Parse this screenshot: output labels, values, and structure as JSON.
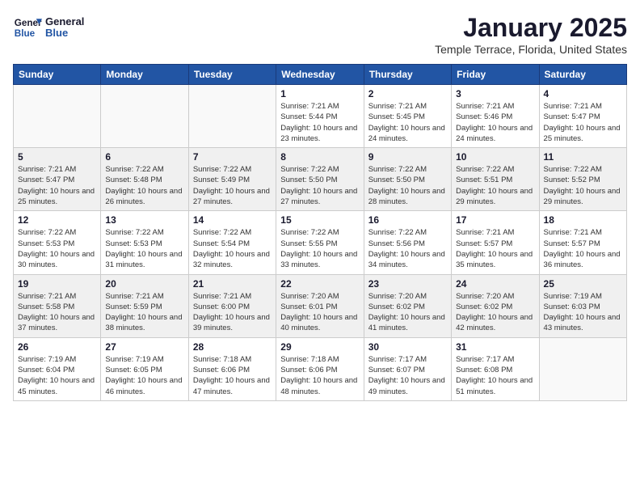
{
  "logo": {
    "line1": "General",
    "line2": "Blue"
  },
  "title": "January 2025",
  "subtitle": "Temple Terrace, Florida, United States",
  "days_of_week": [
    "Sunday",
    "Monday",
    "Tuesday",
    "Wednesday",
    "Thursday",
    "Friday",
    "Saturday"
  ],
  "weeks": [
    {
      "shaded": false,
      "days": [
        {
          "num": "",
          "empty": true
        },
        {
          "num": "",
          "empty": true
        },
        {
          "num": "",
          "empty": true
        },
        {
          "num": "1",
          "sunrise": "7:21 AM",
          "sunset": "5:44 PM",
          "daylight": "10 hours and 23 minutes."
        },
        {
          "num": "2",
          "sunrise": "7:21 AM",
          "sunset": "5:45 PM",
          "daylight": "10 hours and 24 minutes."
        },
        {
          "num": "3",
          "sunrise": "7:21 AM",
          "sunset": "5:46 PM",
          "daylight": "10 hours and 24 minutes."
        },
        {
          "num": "4",
          "sunrise": "7:21 AM",
          "sunset": "5:47 PM",
          "daylight": "10 hours and 25 minutes."
        }
      ]
    },
    {
      "shaded": true,
      "days": [
        {
          "num": "5",
          "sunrise": "7:21 AM",
          "sunset": "5:47 PM",
          "daylight": "10 hours and 25 minutes."
        },
        {
          "num": "6",
          "sunrise": "7:22 AM",
          "sunset": "5:48 PM",
          "daylight": "10 hours and 26 minutes."
        },
        {
          "num": "7",
          "sunrise": "7:22 AM",
          "sunset": "5:49 PM",
          "daylight": "10 hours and 27 minutes."
        },
        {
          "num": "8",
          "sunrise": "7:22 AM",
          "sunset": "5:50 PM",
          "daylight": "10 hours and 27 minutes."
        },
        {
          "num": "9",
          "sunrise": "7:22 AM",
          "sunset": "5:50 PM",
          "daylight": "10 hours and 28 minutes."
        },
        {
          "num": "10",
          "sunrise": "7:22 AM",
          "sunset": "5:51 PM",
          "daylight": "10 hours and 29 minutes."
        },
        {
          "num": "11",
          "sunrise": "7:22 AM",
          "sunset": "5:52 PM",
          "daylight": "10 hours and 29 minutes."
        }
      ]
    },
    {
      "shaded": false,
      "days": [
        {
          "num": "12",
          "sunrise": "7:22 AM",
          "sunset": "5:53 PM",
          "daylight": "10 hours and 30 minutes."
        },
        {
          "num": "13",
          "sunrise": "7:22 AM",
          "sunset": "5:53 PM",
          "daylight": "10 hours and 31 minutes."
        },
        {
          "num": "14",
          "sunrise": "7:22 AM",
          "sunset": "5:54 PM",
          "daylight": "10 hours and 32 minutes."
        },
        {
          "num": "15",
          "sunrise": "7:22 AM",
          "sunset": "5:55 PM",
          "daylight": "10 hours and 33 minutes."
        },
        {
          "num": "16",
          "sunrise": "7:22 AM",
          "sunset": "5:56 PM",
          "daylight": "10 hours and 34 minutes."
        },
        {
          "num": "17",
          "sunrise": "7:21 AM",
          "sunset": "5:57 PM",
          "daylight": "10 hours and 35 minutes."
        },
        {
          "num": "18",
          "sunrise": "7:21 AM",
          "sunset": "5:57 PM",
          "daylight": "10 hours and 36 minutes."
        }
      ]
    },
    {
      "shaded": true,
      "days": [
        {
          "num": "19",
          "sunrise": "7:21 AM",
          "sunset": "5:58 PM",
          "daylight": "10 hours and 37 minutes."
        },
        {
          "num": "20",
          "sunrise": "7:21 AM",
          "sunset": "5:59 PM",
          "daylight": "10 hours and 38 minutes."
        },
        {
          "num": "21",
          "sunrise": "7:21 AM",
          "sunset": "6:00 PM",
          "daylight": "10 hours and 39 minutes."
        },
        {
          "num": "22",
          "sunrise": "7:20 AM",
          "sunset": "6:01 PM",
          "daylight": "10 hours and 40 minutes."
        },
        {
          "num": "23",
          "sunrise": "7:20 AM",
          "sunset": "6:02 PM",
          "daylight": "10 hours and 41 minutes."
        },
        {
          "num": "24",
          "sunrise": "7:20 AM",
          "sunset": "6:02 PM",
          "daylight": "10 hours and 42 minutes."
        },
        {
          "num": "25",
          "sunrise": "7:19 AM",
          "sunset": "6:03 PM",
          "daylight": "10 hours and 43 minutes."
        }
      ]
    },
    {
      "shaded": false,
      "days": [
        {
          "num": "26",
          "sunrise": "7:19 AM",
          "sunset": "6:04 PM",
          "daylight": "10 hours and 45 minutes."
        },
        {
          "num": "27",
          "sunrise": "7:19 AM",
          "sunset": "6:05 PM",
          "daylight": "10 hours and 46 minutes."
        },
        {
          "num": "28",
          "sunrise": "7:18 AM",
          "sunset": "6:06 PM",
          "daylight": "10 hours and 47 minutes."
        },
        {
          "num": "29",
          "sunrise": "7:18 AM",
          "sunset": "6:06 PM",
          "daylight": "10 hours and 48 minutes."
        },
        {
          "num": "30",
          "sunrise": "7:17 AM",
          "sunset": "6:07 PM",
          "daylight": "10 hours and 49 minutes."
        },
        {
          "num": "31",
          "sunrise": "7:17 AM",
          "sunset": "6:08 PM",
          "daylight": "10 hours and 51 minutes."
        },
        {
          "num": "",
          "empty": true
        }
      ]
    }
  ],
  "labels": {
    "sunrise": "Sunrise:",
    "sunset": "Sunset:",
    "daylight": "Daylight:"
  }
}
